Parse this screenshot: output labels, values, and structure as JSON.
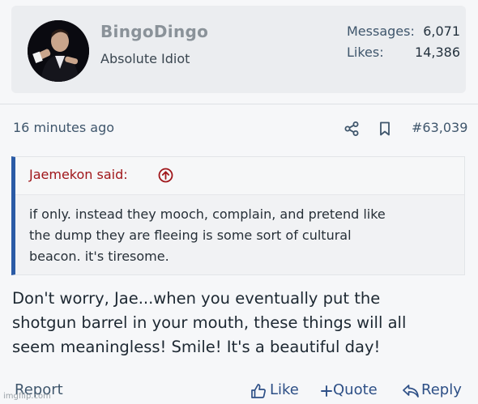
{
  "user": {
    "name": "BingoDingo",
    "title": "Absolute Idiot",
    "stats": [
      {
        "label": "Messages:",
        "value": "6,071"
      },
      {
        "label": "Likes:",
        "value": "14,386"
      }
    ]
  },
  "post": {
    "timestamp": "16 minutes ago",
    "number": "#63,039",
    "quote": {
      "author": "Jaemekon said:",
      "lines": [
        "if only. instead they mooch, complain, and pretend like",
        "the dump they are fleeing is some sort of cultural",
        "beacon. it's tiresome."
      ]
    },
    "message_lines": [
      "Don't worry, Jae...when you eventually put the",
      "shotgun barrel in your mouth, these things will all",
      "seem meaningless! Smile! It's a beautiful day!"
    ]
  },
  "actions": {
    "report": "Report",
    "like": "Like",
    "quote": "Quote",
    "reply": "Reply"
  },
  "watermark": "imgflip.com",
  "colors": {
    "accent": "#2b5ba6",
    "quote_author": "#a0161a",
    "muted": "#3f566c"
  }
}
